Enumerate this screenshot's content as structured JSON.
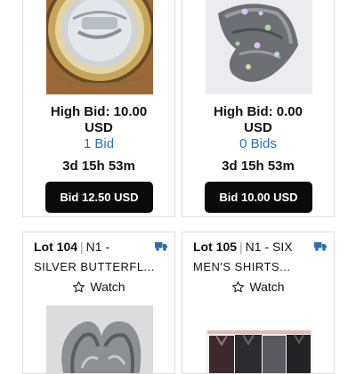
{
  "cards": [
    {
      "image": "coin-image",
      "high_bid": "High Bid: 10.00",
      "currency": "USD",
      "bids": "1 Bid",
      "time_left": "3d 15h 53m",
      "bid_button": "Bid 12.50 USD"
    },
    {
      "image": "brooch-image",
      "high_bid": "High Bid: 0.00",
      "currency": "USD",
      "bids": "0 Bids",
      "time_left": "3d 15h 53m",
      "bid_button": "Bid 10.00 USD"
    },
    {
      "lot": "Lot 104",
      "separator": "|",
      "title_prefix": "N1 -",
      "title_line2": "SILVER BUTTERFL...",
      "watch": "Watch",
      "shipping_icon": "truck-icon",
      "image": "silver-butterfly-image"
    },
    {
      "lot": "Lot 105",
      "separator": "|",
      "title_prefix": "N1 - SIX",
      "title_line2": "MEN'S SHIRTS...",
      "watch": "Watch",
      "shipping_icon": "truck-icon",
      "image": "shirts-image"
    }
  ],
  "colors": {
    "accent": "#2d6db5",
    "button": "#0a0a0a",
    "truck": "#2d6db5"
  }
}
